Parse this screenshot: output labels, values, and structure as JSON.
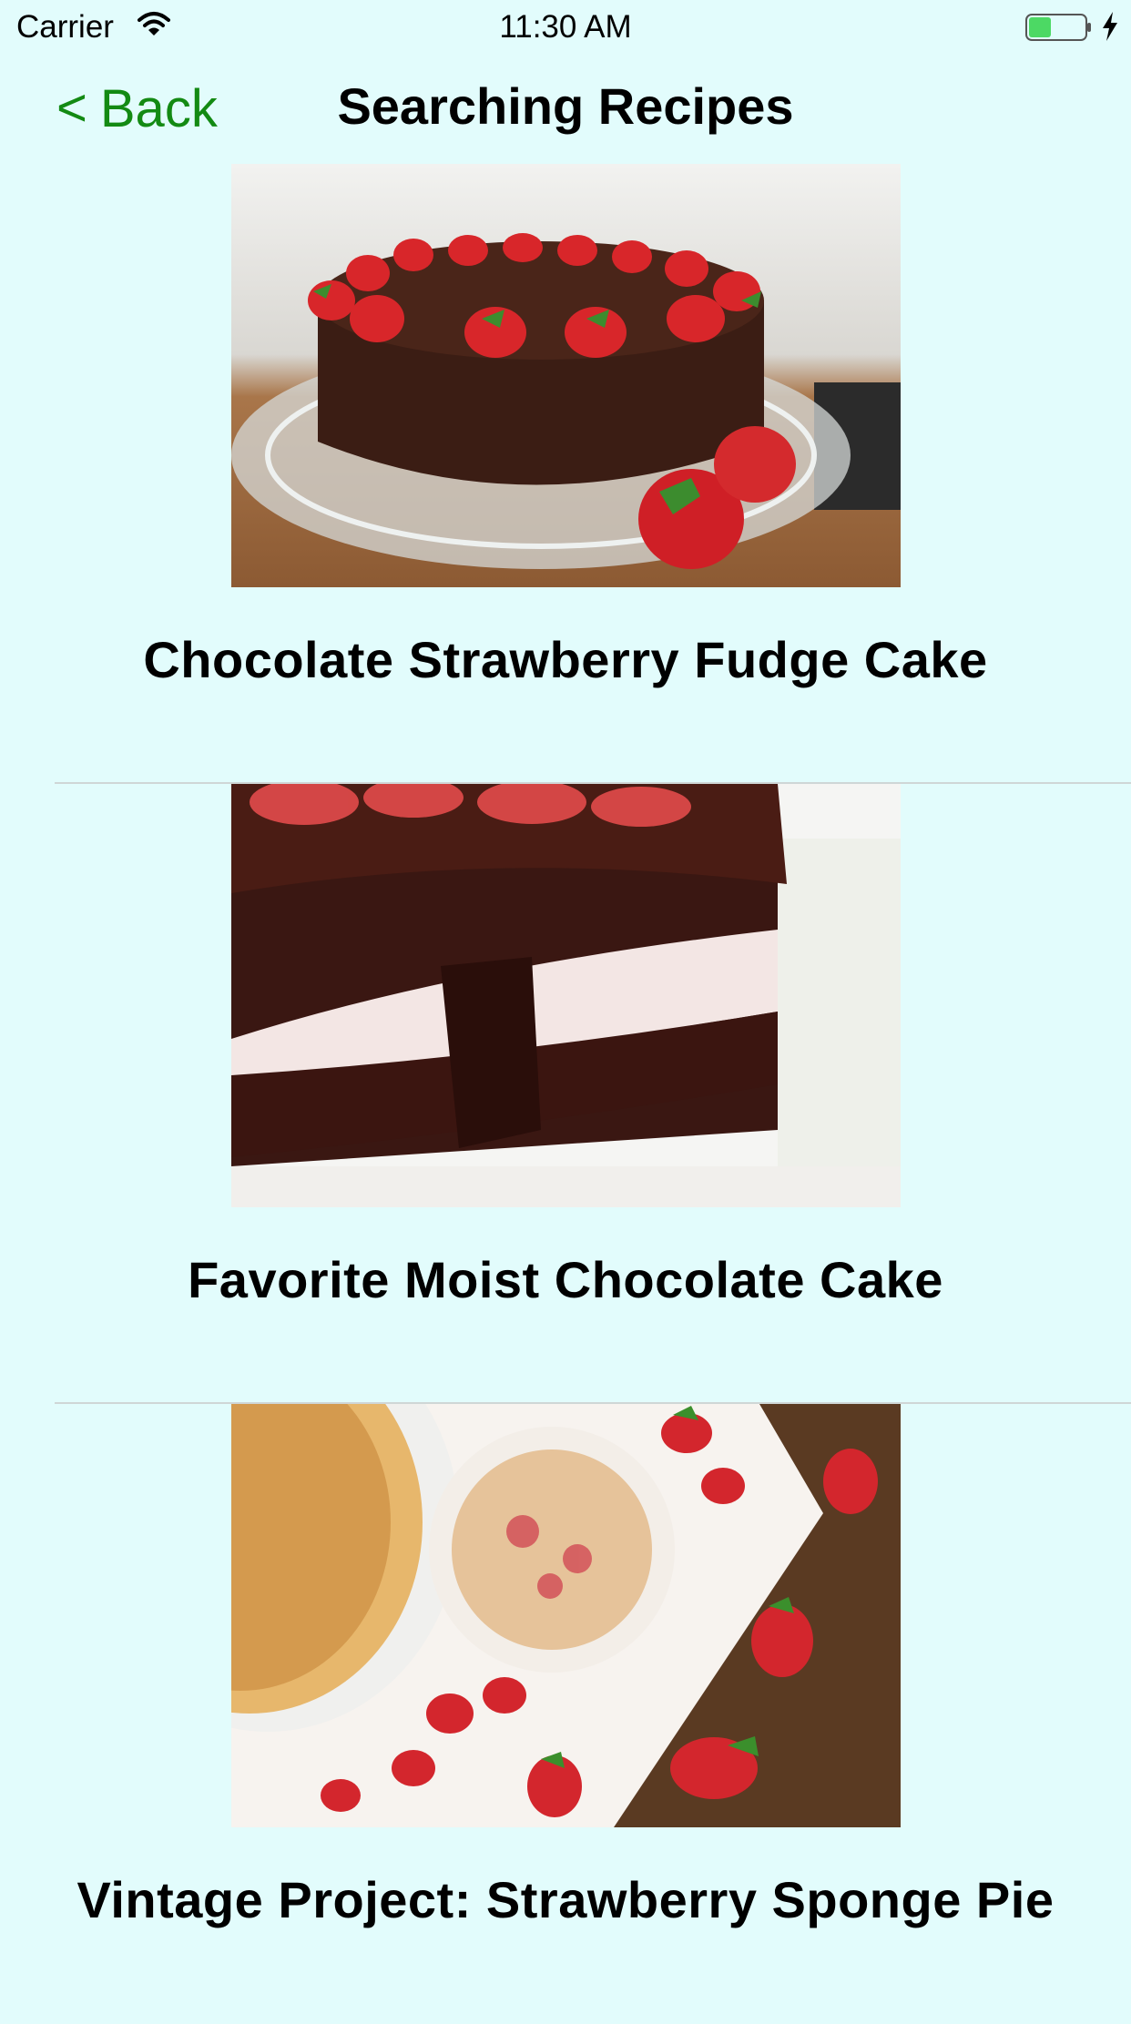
{
  "status_bar": {
    "carrier": "Carrier",
    "time": "11:30 AM",
    "icons": [
      "wifi-icon",
      "battery-icon",
      "charging-bolt-icon"
    ],
    "battery_color": "#4cd964"
  },
  "nav": {
    "back_label": "Back",
    "back_chevron": "<",
    "title": "Searching Recipes",
    "accent_color": "#138a13"
  },
  "recipes": [
    {
      "title": "Chocolate Strawberry Fudge Cake"
    },
    {
      "title": "Favorite Moist Chocolate Cake"
    },
    {
      "title": "Vintage Project: Strawberry Sponge Pie"
    }
  ],
  "background_color": "#e2fcfc"
}
